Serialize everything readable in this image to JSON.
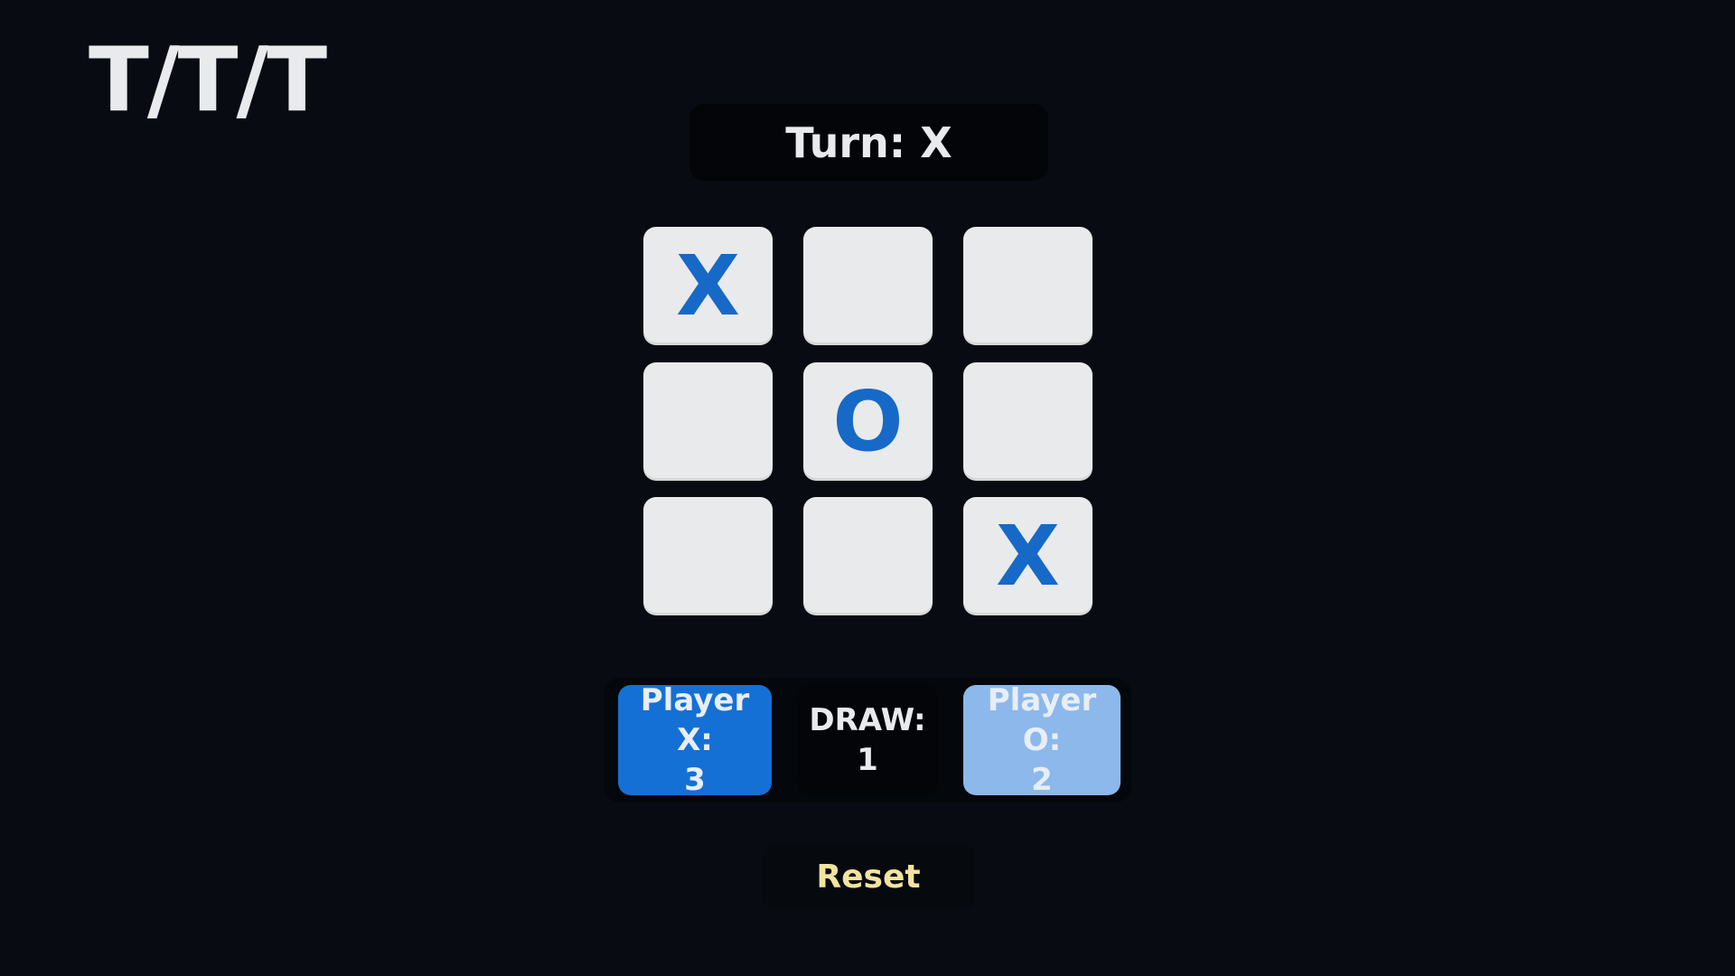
{
  "app": {
    "logo": "T/T/T"
  },
  "status": {
    "turn_text": "Turn: X"
  },
  "board": {
    "cells": [
      "X",
      "",
      "",
      "",
      "O",
      "",
      "",
      "",
      "X"
    ]
  },
  "scores": {
    "x_label": "Player X:",
    "x_value": "3",
    "draw_label": "DRAW:",
    "draw_value": "1",
    "o_label": "Player O:",
    "o_value": "2"
  },
  "controls": {
    "reset_label": "Reset"
  },
  "colors": {
    "background": "#080c12",
    "mark": "#1769c7",
    "player_x": "#1570d6",
    "player_o": "#8cb8ec",
    "reset_text": "#f3e3a0"
  }
}
